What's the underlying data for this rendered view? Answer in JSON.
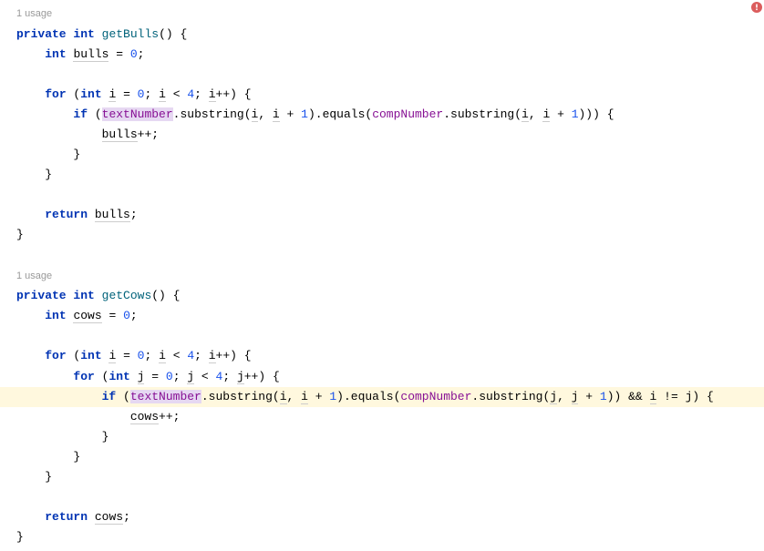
{
  "usage1": "1 usage",
  "usage2": "1 usage",
  "tokens": {
    "private": "private",
    "int": "int",
    "for": "for",
    "if": "if",
    "return": "return",
    "getBulls": "getBulls",
    "getCows": "getCows",
    "bulls": "bulls",
    "cows": "cows",
    "i": "i",
    "j": "j",
    "textNumber": "textNumber",
    "compNumber": "compNumber",
    "substring": "substring",
    "equals": "equals",
    "zero": "0",
    "one": "1",
    "four": "4",
    "pp": "++",
    "amp": "&&",
    "neq": "!="
  }
}
